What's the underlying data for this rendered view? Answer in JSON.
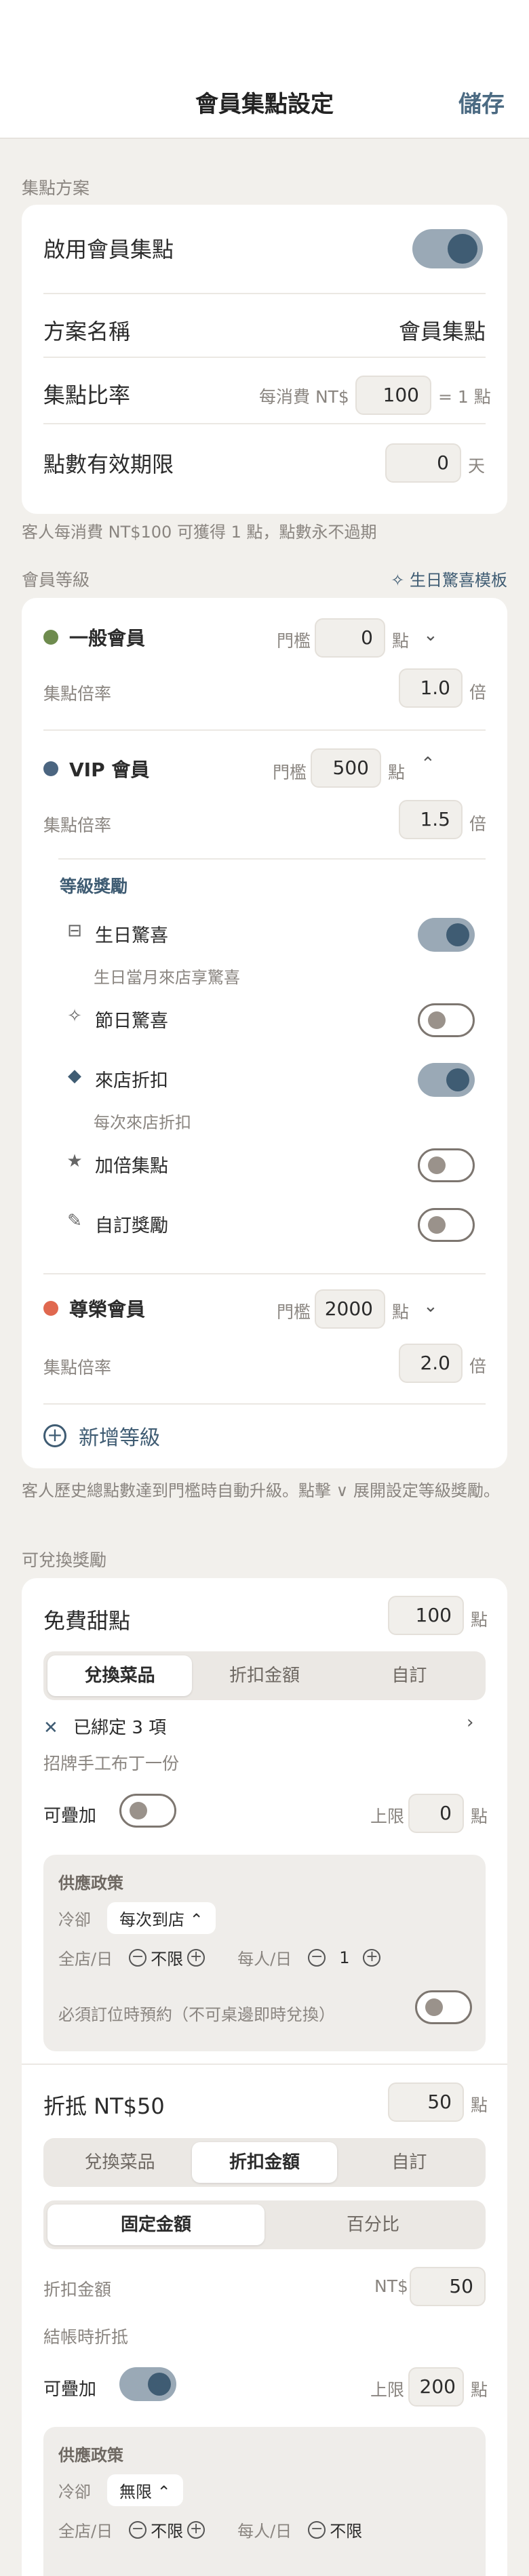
{
  "header": {
    "title": "會員集點設定",
    "save_label": "儲存"
  },
  "points_plan": {
    "section_label": "集點方案",
    "enable_label": "啟用會員集點",
    "enabled": true,
    "name_label": "方案名稱",
    "name_value": "會員集點",
    "ratio_label": "集點比率",
    "ratio_prefix": "每消費 NT$",
    "ratio_value": "100",
    "ratio_suffix": "= 1 點",
    "expiry_label": "點數有效期限",
    "expiry_value": "0",
    "expiry_unit": "天",
    "helper": "客人每消費 NT$100 可獲得 1 點，點數永不過期"
  },
  "levels": {
    "section_label": "會員等級",
    "template_link": "生日驚喜模板",
    "threshold_label": "門檻",
    "points_unit": "點",
    "multiplier_label": "集點倍率",
    "multiplier_unit": "倍",
    "items": [
      {
        "name": "一般會員",
        "color": "#6e8b4e",
        "threshold": "0",
        "multiplier": "1.0"
      },
      {
        "name": "VIP 會員",
        "color": "#4b6580",
        "threshold": "500",
        "multiplier": "1.5"
      },
      {
        "name": "尊榮會員",
        "color": "#e0684f",
        "threshold": "2000",
        "multiplier": "2.0"
      }
    ],
    "rewards_title": "等級獎勵",
    "rewards": [
      {
        "icon": "gift-box-icon",
        "label": "生日驚喜",
        "desc": "生日當月來店享驚喜",
        "on": true
      },
      {
        "icon": "sparkle-icon",
        "label": "節日驚喜",
        "on": false
      },
      {
        "icon": "tag-icon",
        "label": "來店折扣",
        "desc": "每次來店折扣",
        "on": true
      },
      {
        "icon": "star-icon",
        "label": "加倍集點",
        "on": false
      },
      {
        "icon": "pencil-icon",
        "label": "自訂獎勵",
        "on": false
      }
    ],
    "add_label": "新增等級",
    "helper": "客人歷史總點數達到門檻時自動升級。點擊 ∨ 展開設定等級獎勵。"
  },
  "redeem": {
    "section_label": "可兌換獎勵",
    "tabs": [
      "兌換菜品",
      "折扣金額",
      "自訂"
    ],
    "points_unit": "點",
    "stackable_label": "可疊加",
    "cap_label": "上限",
    "policy_title": "供應政策",
    "cooldown_label": "冷卻",
    "store_day_label": "全店/日",
    "person_day_label": "每人/日",
    "unlimited": "不限",
    "items": [
      {
        "title": "免費甜點",
        "points": "100",
        "active_tab": 0,
        "bound_label": "已綁定 3 項",
        "bound_desc": "招牌手工布丁一份",
        "stackable": false,
        "cap": "0",
        "cooldown": "每次到店 ⌃",
        "store_day": "不限",
        "person_day": "1",
        "booking_note": "必須訂位時預約（不可桌邊即時兌換）",
        "booking_on": false
      },
      {
        "title": "折抵 NT$50",
        "points": "50",
        "active_tab": 1,
        "amount_tabs": [
          "固定金額",
          "百分比"
        ],
        "amount_label": "折扣金額",
        "amount_prefix": "NT$",
        "amount_value": "50",
        "checkout_note": "結帳時折抵",
        "stackable": true,
        "cap": "200",
        "cooldown": "無限 ⌃",
        "store_day": "不限",
        "person_day": "不限"
      }
    ]
  }
}
